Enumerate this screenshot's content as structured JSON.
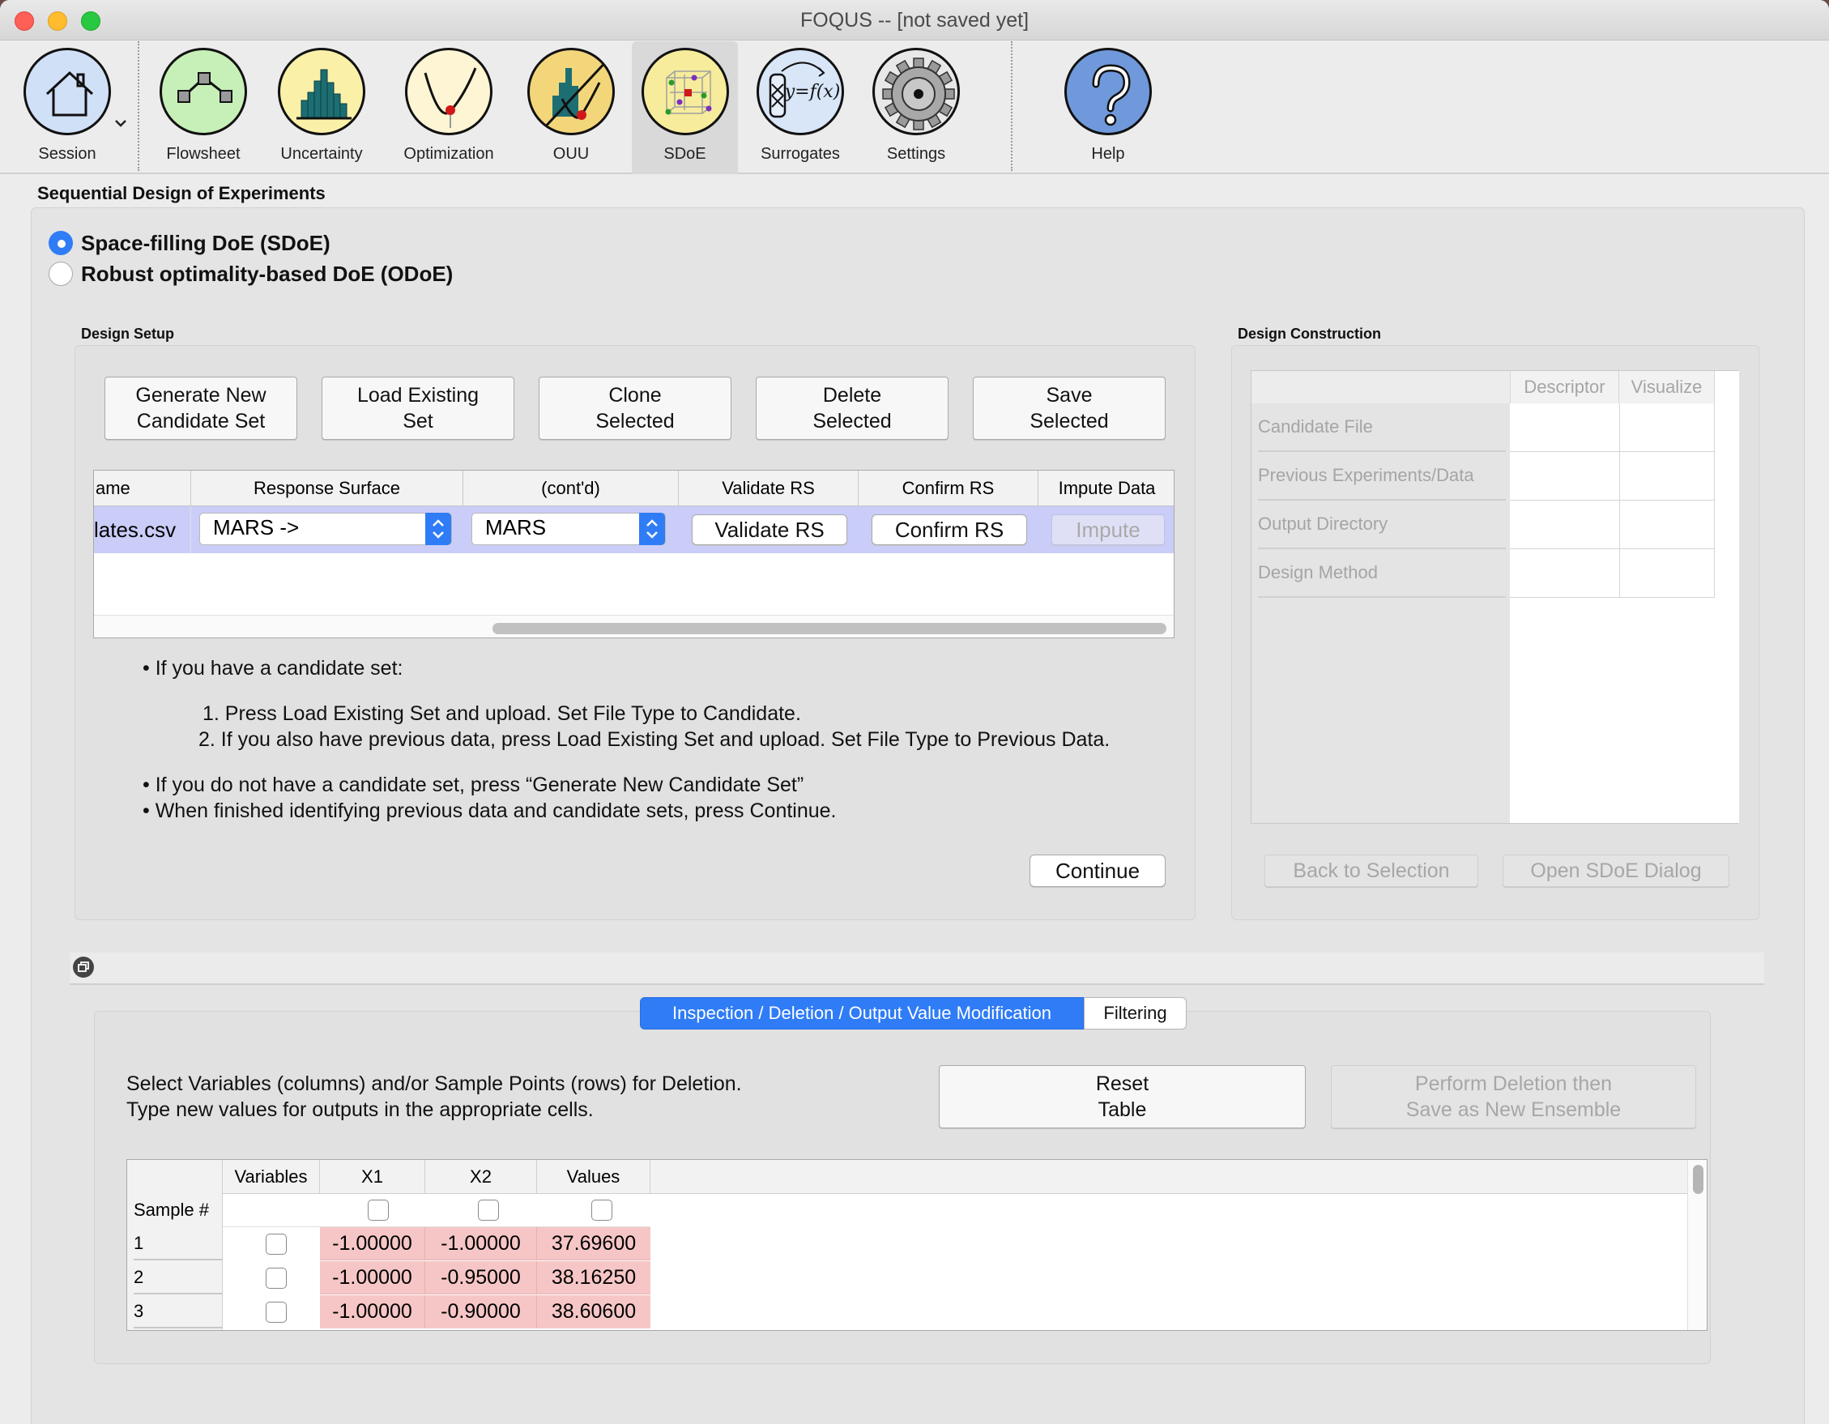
{
  "window": {
    "title": "FOQUS -- [not saved yet]"
  },
  "toolbar": {
    "items": [
      {
        "label": "Session"
      },
      {
        "label": "Flowsheet"
      },
      {
        "label": "Uncertainty"
      },
      {
        "label": "Optimization"
      },
      {
        "label": "OUU"
      },
      {
        "label": "SDoE"
      },
      {
        "label": "Surrogates"
      },
      {
        "label": "Settings"
      },
      {
        "label": "Help"
      }
    ],
    "surrogates_formula": "y=f(x)"
  },
  "page": {
    "title": "Sequential Design of Experiments",
    "mode_options": [
      {
        "label": "Space-filling DoE (SDoE)",
        "selected": true
      },
      {
        "label": "Robust optimality-based DoE (ODoE)",
        "selected": false
      }
    ]
  },
  "design_setup": {
    "title": "Design Setup",
    "buttons": {
      "generate": "Generate New\nCandidate Set",
      "load": "Load Existing\nSet",
      "clone": "Clone\nSelected",
      "delete": "Delete\nSelected",
      "save": "Save\nSelected"
    },
    "table": {
      "headers": [
        "ame",
        "Response Surface",
        "(cont'd)",
        "Validate RS",
        "Confirm RS",
        "Impute Data"
      ],
      "row": {
        "file": "lates.csv",
        "response_surface": "MARS ->",
        "contd": "MARS",
        "validate": "Validate RS",
        "confirm": "Confirm RS",
        "impute": "Impute"
      }
    },
    "instructions": {
      "bullet1": "If you have a candidate set:",
      "step1": "Press Load Existing Set and upload. Set File Type to Candidate.",
      "step2": "If you also have previous data, press Load Existing Set and upload. Set File Type to Previous Data.",
      "bullet2": "If you do not have a candidate set, press “Generate New Candidate Set”",
      "bullet3": "When finished identifying previous data and candidate sets, press Continue."
    },
    "continue_label": "Continue"
  },
  "design_construction": {
    "title": "Design Construction",
    "columns": [
      "Descriptor",
      "Visualize"
    ],
    "rows": [
      "Candidate File",
      "Previous Experiments/Data",
      "Output Directory",
      "Design Method"
    ],
    "back_label": "Back to Selection",
    "open_label": "Open SDoE Dialog"
  },
  "bottom": {
    "tabs": [
      "Inspection / Deletion / Output Value Modification",
      "Filtering"
    ],
    "description_line1": "Select Variables (columns) and/or Sample Points (rows) for Deletion.",
    "description_line2": "Type new values for outputs in the appropriate cells.",
    "reset_label": "Reset\nTable",
    "perform_label": "Perform Deletion then\nSave as New Ensemble",
    "table": {
      "headers": [
        "Variables",
        "X1",
        "X2",
        "Values"
      ],
      "sample_label": "Sample #",
      "rows": [
        {
          "n": "1",
          "x1": "-1.00000",
          "x2": "-1.00000",
          "v": "37.69600"
        },
        {
          "n": "2",
          "x1": "-1.00000",
          "x2": "-0.95000",
          "v": "38.16250"
        },
        {
          "n": "3",
          "x1": "-1.00000",
          "x2": "-0.90000",
          "v": "38.60600"
        }
      ]
    }
  }
}
